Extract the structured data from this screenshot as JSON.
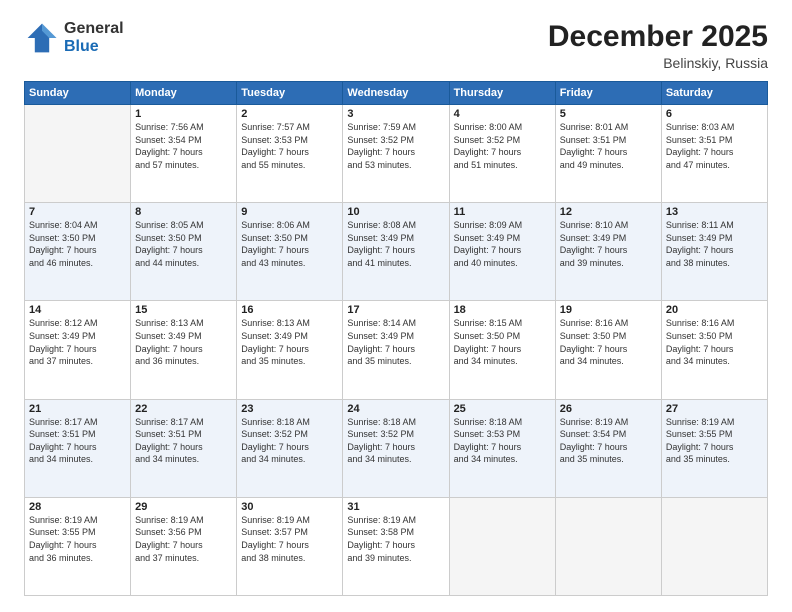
{
  "logo": {
    "general": "General",
    "blue": "Blue"
  },
  "title": "December 2025",
  "location": "Belinskiy, Russia",
  "days_of_week": [
    "Sunday",
    "Monday",
    "Tuesday",
    "Wednesday",
    "Thursday",
    "Friday",
    "Saturday"
  ],
  "weeks": [
    [
      {
        "day": "",
        "sunrise": "",
        "sunset": "",
        "daylight": ""
      },
      {
        "day": "1",
        "sunrise": "7:56 AM",
        "sunset": "3:54 PM",
        "daylight": "7 hours and 57 minutes."
      },
      {
        "day": "2",
        "sunrise": "7:57 AM",
        "sunset": "3:53 PM",
        "daylight": "7 hours and 55 minutes."
      },
      {
        "day": "3",
        "sunrise": "7:59 AM",
        "sunset": "3:52 PM",
        "daylight": "7 hours and 53 minutes."
      },
      {
        "day": "4",
        "sunrise": "8:00 AM",
        "sunset": "3:52 PM",
        "daylight": "7 hours and 51 minutes."
      },
      {
        "day": "5",
        "sunrise": "8:01 AM",
        "sunset": "3:51 PM",
        "daylight": "7 hours and 49 minutes."
      },
      {
        "day": "6",
        "sunrise": "8:03 AM",
        "sunset": "3:51 PM",
        "daylight": "7 hours and 47 minutes."
      }
    ],
    [
      {
        "day": "7",
        "sunrise": "8:04 AM",
        "sunset": "3:50 PM",
        "daylight": "7 hours and 46 minutes."
      },
      {
        "day": "8",
        "sunrise": "8:05 AM",
        "sunset": "3:50 PM",
        "daylight": "7 hours and 44 minutes."
      },
      {
        "day": "9",
        "sunrise": "8:06 AM",
        "sunset": "3:50 PM",
        "daylight": "7 hours and 43 minutes."
      },
      {
        "day": "10",
        "sunrise": "8:08 AM",
        "sunset": "3:49 PM",
        "daylight": "7 hours and 41 minutes."
      },
      {
        "day": "11",
        "sunrise": "8:09 AM",
        "sunset": "3:49 PM",
        "daylight": "7 hours and 40 minutes."
      },
      {
        "day": "12",
        "sunrise": "8:10 AM",
        "sunset": "3:49 PM",
        "daylight": "7 hours and 39 minutes."
      },
      {
        "day": "13",
        "sunrise": "8:11 AM",
        "sunset": "3:49 PM",
        "daylight": "7 hours and 38 minutes."
      }
    ],
    [
      {
        "day": "14",
        "sunrise": "8:12 AM",
        "sunset": "3:49 PM",
        "daylight": "7 hours and 37 minutes."
      },
      {
        "day": "15",
        "sunrise": "8:13 AM",
        "sunset": "3:49 PM",
        "daylight": "7 hours and 36 minutes."
      },
      {
        "day": "16",
        "sunrise": "8:13 AM",
        "sunset": "3:49 PM",
        "daylight": "7 hours and 35 minutes."
      },
      {
        "day": "17",
        "sunrise": "8:14 AM",
        "sunset": "3:49 PM",
        "daylight": "7 hours and 35 minutes."
      },
      {
        "day": "18",
        "sunrise": "8:15 AM",
        "sunset": "3:50 PM",
        "daylight": "7 hours and 34 minutes."
      },
      {
        "day": "19",
        "sunrise": "8:16 AM",
        "sunset": "3:50 PM",
        "daylight": "7 hours and 34 minutes."
      },
      {
        "day": "20",
        "sunrise": "8:16 AM",
        "sunset": "3:50 PM",
        "daylight": "7 hours and 34 minutes."
      }
    ],
    [
      {
        "day": "21",
        "sunrise": "8:17 AM",
        "sunset": "3:51 PM",
        "daylight": "7 hours and 34 minutes."
      },
      {
        "day": "22",
        "sunrise": "8:17 AM",
        "sunset": "3:51 PM",
        "daylight": "7 hours and 34 minutes."
      },
      {
        "day": "23",
        "sunrise": "8:18 AM",
        "sunset": "3:52 PM",
        "daylight": "7 hours and 34 minutes."
      },
      {
        "day": "24",
        "sunrise": "8:18 AM",
        "sunset": "3:52 PM",
        "daylight": "7 hours and 34 minutes."
      },
      {
        "day": "25",
        "sunrise": "8:18 AM",
        "sunset": "3:53 PM",
        "daylight": "7 hours and 34 minutes."
      },
      {
        "day": "26",
        "sunrise": "8:19 AM",
        "sunset": "3:54 PM",
        "daylight": "7 hours and 35 minutes."
      },
      {
        "day": "27",
        "sunrise": "8:19 AM",
        "sunset": "3:55 PM",
        "daylight": "7 hours and 35 minutes."
      }
    ],
    [
      {
        "day": "28",
        "sunrise": "8:19 AM",
        "sunset": "3:55 PM",
        "daylight": "7 hours and 36 minutes."
      },
      {
        "day": "29",
        "sunrise": "8:19 AM",
        "sunset": "3:56 PM",
        "daylight": "7 hours and 37 minutes."
      },
      {
        "day": "30",
        "sunrise": "8:19 AM",
        "sunset": "3:57 PM",
        "daylight": "7 hours and 38 minutes."
      },
      {
        "day": "31",
        "sunrise": "8:19 AM",
        "sunset": "3:58 PM",
        "daylight": "7 hours and 39 minutes."
      },
      {
        "day": "",
        "sunrise": "",
        "sunset": "",
        "daylight": ""
      },
      {
        "day": "",
        "sunrise": "",
        "sunset": "",
        "daylight": ""
      },
      {
        "day": "",
        "sunrise": "",
        "sunset": "",
        "daylight": ""
      }
    ]
  ]
}
